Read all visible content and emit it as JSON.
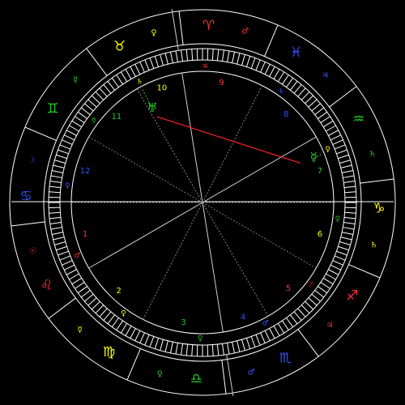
{
  "colors": {
    "background": "#000000",
    "lines": "#ffffff",
    "fire": "#ff3030",
    "earth": "#ffff00",
    "air": "#22cc22",
    "water": "#3355ff",
    "aspect_opposition": "#ff2020"
  },
  "zodiac_signs": [
    {
      "glyph": "♈",
      "name": "aries-sign",
      "color": "#ff3030"
    },
    {
      "glyph": "♉",
      "name": "taurus-sign",
      "color": "#ffff00"
    },
    {
      "glyph": "♊",
      "name": "gemini-sign",
      "color": "#22cc22"
    },
    {
      "glyph": "♋",
      "name": "cancer-sign",
      "color": "#3355ff"
    },
    {
      "glyph": "♌",
      "name": "leo-sign",
      "color": "#ff3030"
    },
    {
      "glyph": "♍",
      "name": "virgo-sign",
      "color": "#ffff00"
    },
    {
      "glyph": "♎",
      "name": "libra-sign",
      "color": "#22cc22"
    },
    {
      "glyph": "♏",
      "name": "scorpio-sign",
      "color": "#3355ff"
    },
    {
      "glyph": "♐",
      "name": "sagittarius-sign",
      "color": "#ff3030"
    },
    {
      "glyph": "♑",
      "name": "capricorn-sign",
      "color": "#ffff00"
    },
    {
      "glyph": "♒",
      "name": "aquarius-sign",
      "color": "#22cc22"
    },
    {
      "glyph": "♓",
      "name": "pisces-sign",
      "color": "#3355ff"
    }
  ],
  "rulers": [
    {
      "glyph": "♂",
      "name": "mars-ruler",
      "color": "#ff3030"
    },
    {
      "glyph": "♀",
      "name": "venus-ruler",
      "color": "#ffff00"
    },
    {
      "glyph": "☿",
      "name": "mercury-ruler",
      "color": "#22cc22"
    },
    {
      "glyph": "☽",
      "name": "moon-ruler",
      "color": "#3355ff"
    },
    {
      "glyph": "☉",
      "name": "sun-ruler",
      "color": "#ff3030"
    },
    {
      "glyph": "☿",
      "name": "mercury-ruler",
      "color": "#ffff00"
    },
    {
      "glyph": "♀",
      "name": "venus-ruler",
      "color": "#22cc22"
    },
    {
      "glyph": "♂",
      "name": "mars-ruler",
      "color": "#3355ff"
    },
    {
      "glyph": "♃",
      "name": "jupiter-ruler",
      "color": "#ff3030"
    },
    {
      "glyph": "♄",
      "name": "saturn-ruler",
      "color": "#ffff00"
    },
    {
      "glyph": "♄",
      "name": "saturn-ruler",
      "color": "#22cc22"
    },
    {
      "glyph": "♃",
      "name": "jupiter-ruler",
      "color": "#3355ff"
    }
  ],
  "houses": [
    {
      "num": "1",
      "color": "#ff3030",
      "ruler": "♂",
      "ruler_color": "#ff3030"
    },
    {
      "num": "2",
      "color": "#ffff00",
      "ruler": "♀",
      "ruler_color": "#ffff00"
    },
    {
      "num": "3",
      "color": "#22cc22",
      "ruler": "♀",
      "ruler_color": "#22cc22"
    },
    {
      "num": "4",
      "color": "#3355ff",
      "ruler": "♂",
      "ruler_color": "#3355ff"
    },
    {
      "num": "5",
      "color": "#ff3030",
      "ruler": "☉",
      "ruler_color": "#ff3030"
    },
    {
      "num": "6",
      "color": "#ffff00",
      "ruler": "♀",
      "ruler_color": "#22cc22"
    },
    {
      "num": "7",
      "color": "#22cc22",
      "ruler": "♀",
      "ruler_color": "#ffff00"
    },
    {
      "num": "8",
      "color": "#3355ff",
      "ruler": "♄",
      "ruler_color": "#3355ff"
    },
    {
      "num": "9",
      "color": "#ff3030",
      "ruler": "♃",
      "ruler_color": "#ff3030"
    },
    {
      "num": "10",
      "color": "#ffff00",
      "ruler": "♄",
      "ruler_color": "#ffff00"
    },
    {
      "num": "11",
      "color": "#22cc22",
      "ruler": "☿",
      "ruler_color": "#22cc22"
    },
    {
      "num": "12",
      "color": "#3355ff",
      "ruler": "♀",
      "ruler_color": "#3355ff"
    }
  ],
  "planets": [
    {
      "glyph": "♅",
      "name": "uranus-planet",
      "color": "#22cc22"
    },
    {
      "glyph": "☿",
      "name": "mercury-planet",
      "color": "#22cc22"
    }
  ],
  "aspects": [
    {
      "type": "opposition",
      "from": "uranus-planet",
      "to": "mercury-planet",
      "color": "#ff2020"
    }
  ]
}
